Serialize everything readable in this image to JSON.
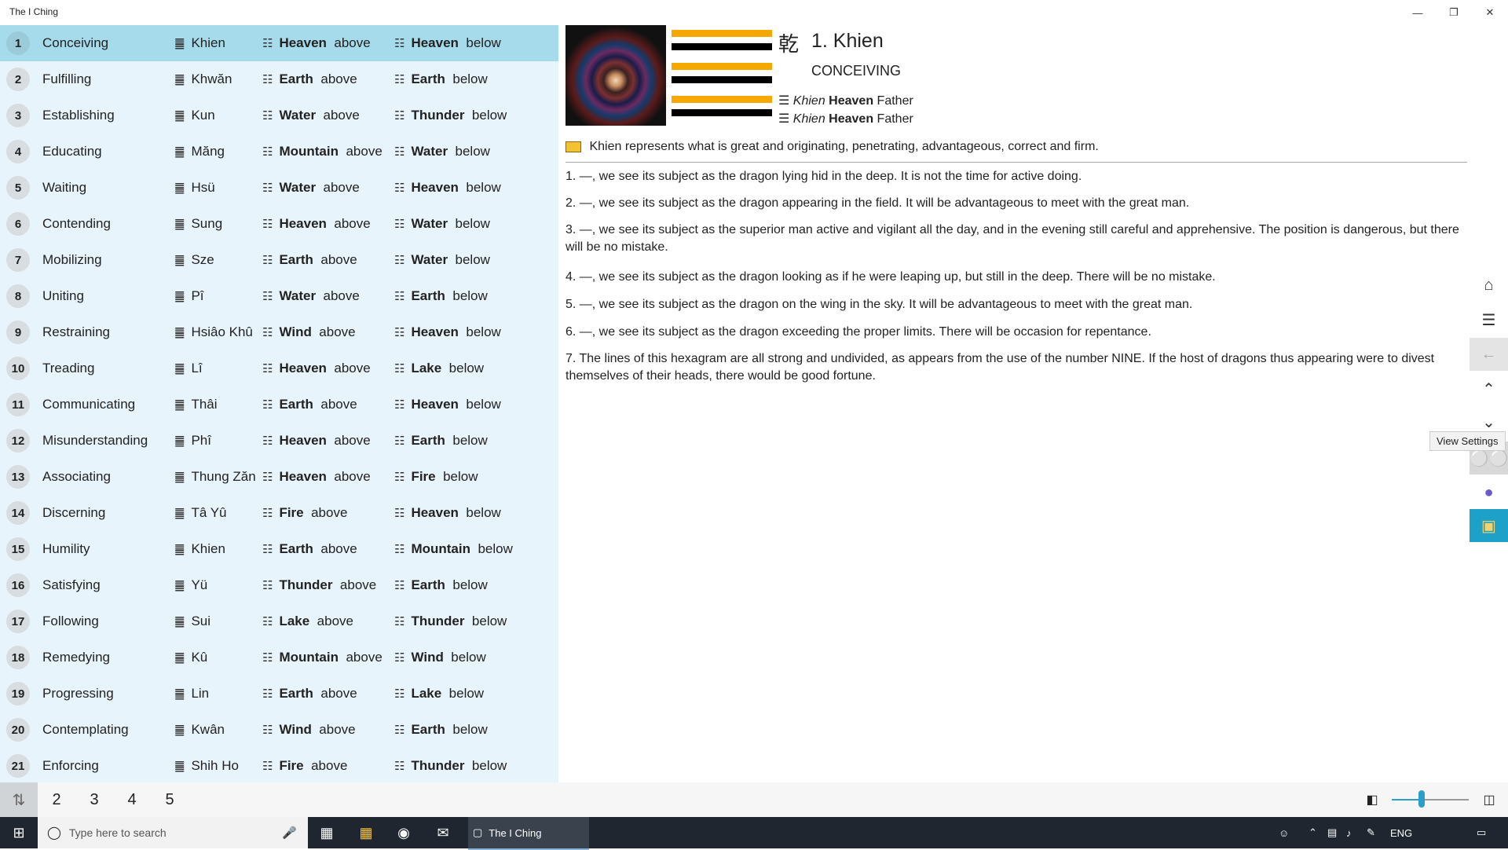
{
  "window": {
    "title": "The I Ching",
    "controls": [
      "minimize-icon",
      "restore-icon",
      "close-icon"
    ]
  },
  "list": [
    {
      "num": "1",
      "name": "Conceiving",
      "hex": "Khien",
      "above": "Heaven",
      "below": "Heaven",
      "selected": true
    },
    {
      "num": "2",
      "name": "Fulfilling",
      "hex": "Khwăn",
      "above": "Earth",
      "below": "Earth"
    },
    {
      "num": "3",
      "name": "Establishing",
      "hex": "Kun",
      "above": "Water",
      "below": "Thunder"
    },
    {
      "num": "4",
      "name": "Educating",
      "hex": "Măng",
      "above": "Mountain",
      "below": "Water"
    },
    {
      "num": "5",
      "name": "Waiting",
      "hex": "Hsü",
      "above": "Water",
      "below": "Heaven"
    },
    {
      "num": "6",
      "name": "Contending",
      "hex": "Sung",
      "above": "Heaven",
      "below": "Water"
    },
    {
      "num": "7",
      "name": "Mobilizing",
      "hex": "Sze",
      "above": "Earth",
      "below": "Water"
    },
    {
      "num": "8",
      "name": "Uniting",
      "hex": "Pî",
      "above": "Water",
      "below": "Earth"
    },
    {
      "num": "9",
      "name": "Restraining",
      "hex": "Hsiâo Khû",
      "above": "Wind",
      "below": "Heaven"
    },
    {
      "num": "10",
      "name": "Treading",
      "hex": "Lî",
      "above": "Heaven",
      "below": "Lake"
    },
    {
      "num": "11",
      "name": "Communicating",
      "hex": "Thâi",
      "above": "Earth",
      "below": "Heaven"
    },
    {
      "num": "12",
      "name": "Misunderstanding",
      "hex": "Phî",
      "above": "Heaven",
      "below": "Earth"
    },
    {
      "num": "13",
      "name": "Associating",
      "hex": "Thung Zăn",
      "above": "Heaven",
      "below": "Fire"
    },
    {
      "num": "14",
      "name": "Discerning",
      "hex": "Tâ Yû",
      "above": "Fire",
      "below": "Heaven"
    },
    {
      "num": "15",
      "name": "Humility",
      "hex": "Khien",
      "above": "Earth",
      "below": "Mountain"
    },
    {
      "num": "16",
      "name": "Satisfying",
      "hex": "Yü",
      "above": "Thunder",
      "below": "Earth"
    },
    {
      "num": "17",
      "name": "Following",
      "hex": "Sui",
      "above": "Lake",
      "below": "Thunder"
    },
    {
      "num": "18",
      "name": "Remedying",
      "hex": "Kû",
      "above": "Mountain",
      "below": "Wind"
    },
    {
      "num": "19",
      "name": "Progressing",
      "hex": "Lin",
      "above": "Earth",
      "below": "Lake"
    },
    {
      "num": "20",
      "name": "Contemplating",
      "hex": "Kwân",
      "above": "Wind",
      "below": "Earth"
    },
    {
      "num": "21",
      "name": "Enforcing",
      "hex": "Shih Ho",
      "above": "Fire",
      "below": "Thunder"
    }
  ],
  "labels": {
    "above": "above",
    "below": "below"
  },
  "detail": {
    "hanzi": "乾",
    "heading": "1. Khien",
    "subtitle": "CONCEIVING",
    "upper": {
      "name": "Khien",
      "element": "Heaven",
      "role": "Father"
    },
    "lower": {
      "name": "Khien",
      "element": "Heaven",
      "role": "Father"
    },
    "judgement": "Khien represents what is great and originating, penetrating, advantageous, correct and firm.",
    "lines": [
      "1. —, we see its subject as the dragon lying hid in the deep. It is not the time for active doing.",
      "2. —, we see its subject as the dragon appearing in the field. It will be advantageous to meet with the great man.",
      "3. —, we see its subject as the superior man active and vigilant all the day, and in the evening still careful and apprehensive. The position is dangerous, but there will be no mistake.",
      "4. —, we see its subject as the dragon looking as if he were leaping up, but still in the deep. There will be no mistake.",
      "5. —, we see its subject as the dragon on the wing in the sky. It will be advantageous to meet with the great man.",
      "6. —, we see its subject as the dragon exceeding the proper limits. There will be occasion for repentance.",
      "7. The lines of this hexagram are all strong and undivided, as appears from the use of the number NINE. If the host of dragons thus appearing were to divest themselves of their heads, there would be good fortune."
    ],
    "bar_colors": [
      "#f5a800",
      "#000000",
      "#f5a800",
      "#000000",
      "#f5a800",
      "#000000"
    ]
  },
  "tooltip": "View Settings",
  "pager": {
    "pages": [
      "2",
      "3",
      "4",
      "5"
    ]
  },
  "zoom": {
    "level": 0.4
  },
  "taskbar": {
    "search_placeholder": "Type here to search",
    "active_app": "The I Ching",
    "lang": "ENG"
  },
  "colors": {
    "accent": "#2aa0c8",
    "selected_row": "#a6dbec",
    "list_bg": "#e8f4fb",
    "bar_yellow": "#f5a800"
  }
}
